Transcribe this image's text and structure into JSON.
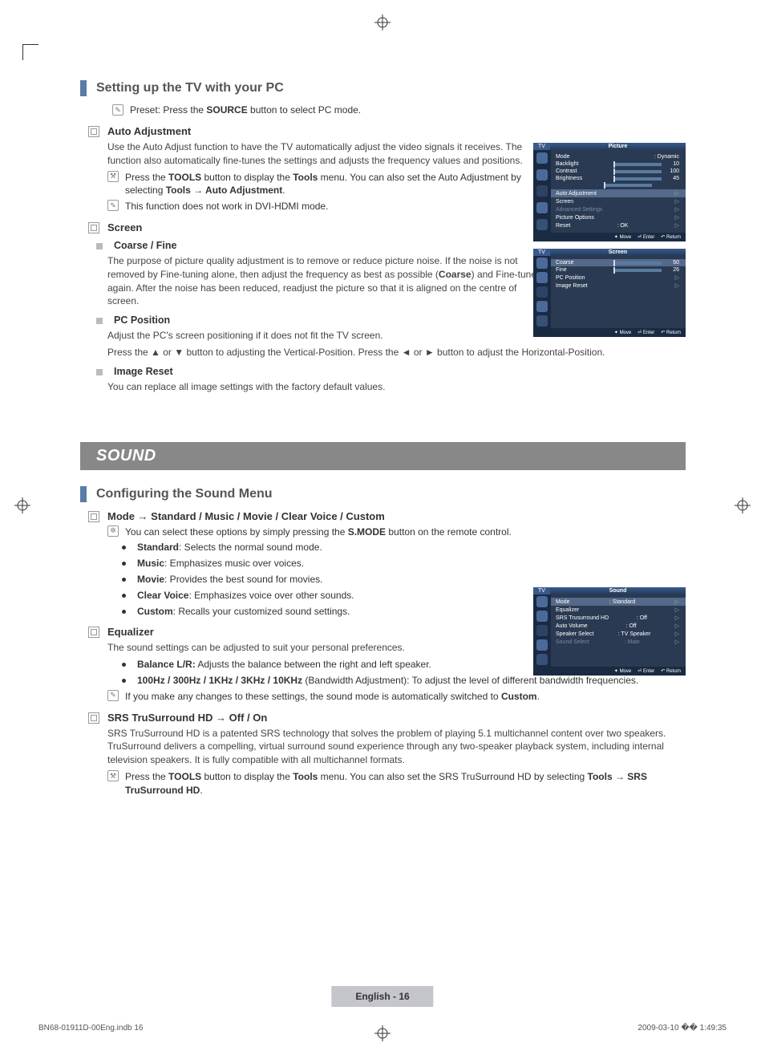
{
  "section1": {
    "title": "Setting up the TV with your PC",
    "preset_prefix": "Preset: Press the ",
    "preset_bold": "SOURCE",
    "preset_suffix": " button to select PC mode.",
    "auto_adj": {
      "title": "Auto Adjustment",
      "body": "Use the Auto Adjust function to have the TV automatically adjust the video signals it receives. The function also automatically fine-tunes the settings and adjusts the frequency values and positions.",
      "tool_prefix": "Press the ",
      "tool_b1": "TOOLS",
      "tool_mid1": " button to display the ",
      "tool_b2": "Tools",
      "tool_mid2": " menu. You can also set the Auto Adjustment by selecting ",
      "tool_b3": "Tools → Auto Adjustment",
      "tool_suffix": ".",
      "note": "This function does not work in DVI-HDMI mode."
    },
    "screen": {
      "title": "Screen",
      "coarse": {
        "title": "Coarse / Fine",
        "body_prefix": "The purpose of picture quality adjustment is to remove or reduce picture noise. If the noise is not removed by Fine-tuning alone, then adjust the frequency as best as possible (",
        "body_bold": "Coarse",
        "body_suffix": ") and Fine-tune again. After the noise has been reduced, readjust the picture so that it is aligned on the centre of screen."
      },
      "pcpos": {
        "title": "PC Position",
        "l1": "Adjust the PC's screen positioning if it does not fit the TV screen.",
        "l2": "Press the ▲ or ▼ button to adjusting the Vertical-Position. Press the ◄ or ► button to adjust the Horizontal-Position."
      },
      "imgreset": {
        "title": "Image Reset",
        "body": "You can replace all image settings with the factory default values."
      }
    }
  },
  "sound_header": "SOUND",
  "section2": {
    "title": "Configuring the Sound Menu",
    "mode": {
      "title": "Mode → Standard / Music / Movie / Clear Voice / Custom",
      "note_prefix": "You can select these options by simply pressing the ",
      "note_bold": "S.MODE",
      "note_suffix": " button on the remote control.",
      "std_b": "Standard",
      "std_t": ": Selects the normal sound mode.",
      "mus_b": "Music",
      "mus_t": ": Emphasizes music over voices.",
      "mov_b": "Movie",
      "mov_t": ": Provides the best sound for movies.",
      "cv_b": "Clear Voice",
      "cv_t": ": Emphasizes voice over other sounds.",
      "cus_b": "Custom",
      "cus_t": ": Recalls your customized sound settings."
    },
    "eq": {
      "title": "Equalizer",
      "body": "The sound settings can be adjusted to suit your personal preferences.",
      "bal_b": "Balance L/R:",
      "bal_t": " Adjusts the balance between the right and left speaker.",
      "bw_b": "100Hz / 300Hz / 1KHz / 3KHz / 10KHz",
      "bw_t": " (Bandwidth Adjustment): To adjust the level of different bandwidth frequencies.",
      "note_prefix": "If you make any changes to these settings, the sound mode is automatically switched to ",
      "note_bold": "Custom",
      "note_suffix": "."
    },
    "srs": {
      "title": "SRS TruSurround HD → Off / On",
      "body": "SRS TruSurround HD is a patented SRS technology that solves the problem of playing 5.1 multichannel content over two speakers. TruSurround delivers a compelling, virtual surround sound experience through any two-speaker playback system, including internal television speakers. It is fully compatible with all multichannel formats.",
      "tool_prefix": "Press the ",
      "tool_b1": "TOOLS",
      "tool_mid1": " button to display the ",
      "tool_b2": "Tools",
      "tool_mid2": " menu. You can also set the SRS TruSurround HD by selecting ",
      "tool_b3": "Tools → SRS TruSurround HD",
      "tool_suffix": "."
    }
  },
  "osd1": {
    "tab": "TV",
    "title": "Picture",
    "rows": [
      {
        "label": "Mode",
        "value": ": Dynamic"
      },
      {
        "label": "Backlight",
        "value": "10"
      },
      {
        "label": "Contrast",
        "value": "100"
      },
      {
        "label": "Brightness",
        "value": "45"
      }
    ],
    "menu": [
      "Auto Adjustment",
      "Screen",
      "Advanced Settings",
      "Picture Options",
      "Reset"
    ],
    "reset_val": ": OK",
    "footer": [
      "Move",
      "Enter",
      "Return"
    ]
  },
  "osd2": {
    "tab": "TV",
    "title": "Screen",
    "rows": [
      {
        "label": "Coarse",
        "value": "50"
      },
      {
        "label": "Fine",
        "value": "26"
      },
      {
        "label": "PC Position",
        "value": ""
      },
      {
        "label": "Image Reset",
        "value": ""
      }
    ],
    "footer": [
      "Move",
      "Enter",
      "Return"
    ]
  },
  "osd3": {
    "tab": "TV",
    "title": "Sound",
    "rows": [
      {
        "label": "Mode",
        "value": ": Standard"
      },
      {
        "label": "Equalizer",
        "value": ""
      },
      {
        "label": "SRS Trusurround HD",
        "value": ": Off"
      },
      {
        "label": "Auto Volume",
        "value": ": Off"
      },
      {
        "label": "Speaker Select",
        "value": ": TV Speaker"
      },
      {
        "label": "Sound Select",
        "value": ": Main"
      }
    ],
    "footer": [
      "Move",
      "Enter",
      "Return"
    ]
  },
  "page_footer": "English - 16",
  "doc_file": "BN68-01911D-00Eng.indb   16",
  "doc_date": "2009-03-10   �� 1:49:35"
}
